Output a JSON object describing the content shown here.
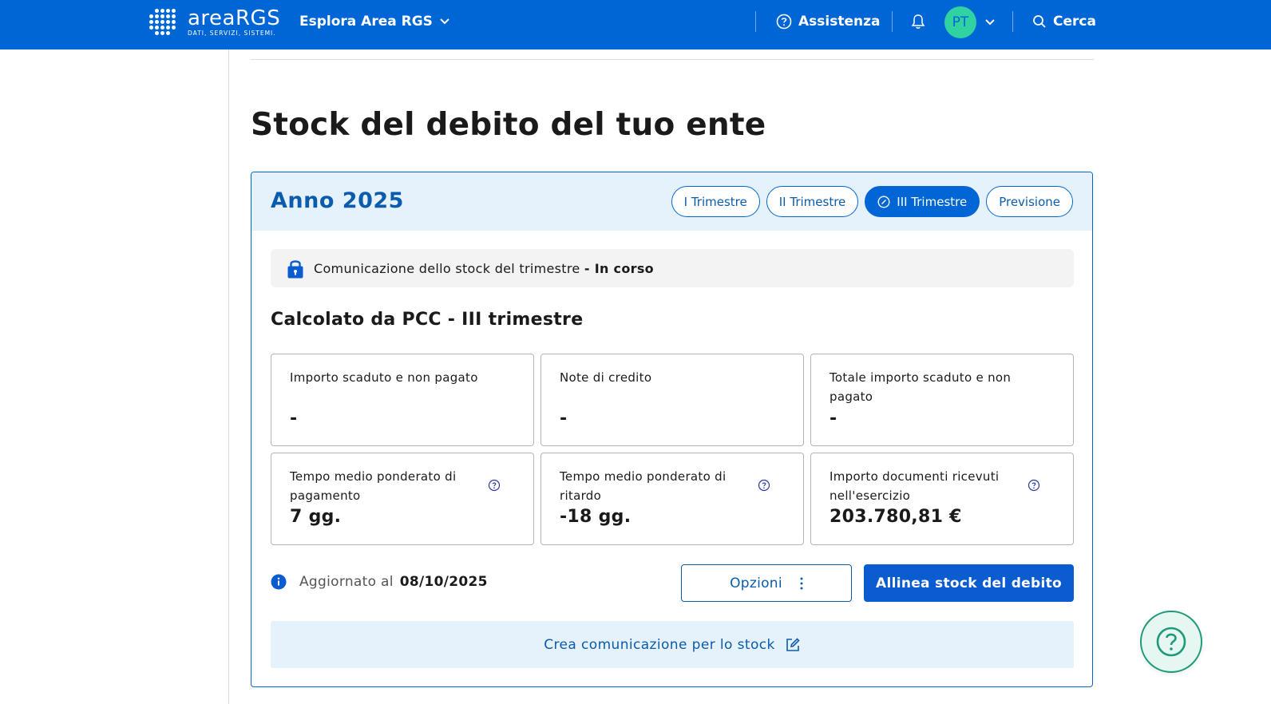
{
  "header": {
    "logo_name": "areaRGS",
    "logo_tagline": "DATI, SERVIZI, SISTEMI.",
    "explore_label": "Esplora Area RGS",
    "help_label": "Assistenza",
    "avatar_initials": "PT",
    "search_label": "Cerca",
    "icons": [
      "grid-dots-icon",
      "chevron-down-icon",
      "question-circle-icon",
      "bell-icon",
      "search-icon"
    ]
  },
  "page": {
    "title": "Stock del debito del tuo ente"
  },
  "card": {
    "year_label": "Anno 2025",
    "tabs": [
      {
        "label": "I Trimestre",
        "active": false
      },
      {
        "label": "II Trimestre",
        "active": false
      },
      {
        "label": "III Trimestre",
        "active": true
      },
      {
        "label": "Previsione",
        "active": false
      }
    ],
    "notice": {
      "text": "Comunicazione dello stock del trimestre",
      "status": "- In corso",
      "icon": "lock-icon"
    },
    "section_title": "Calcolato da PCC - III trimestre",
    "metrics": [
      {
        "label": "Importo scaduto e non pagato",
        "value": "-"
      },
      {
        "label": "Note di credito",
        "value": "-"
      },
      {
        "label": "Totale importo scaduto e non pagato",
        "value": "-"
      },
      {
        "label": "Tempo medio ponderato di pagamento",
        "value": "7 gg."
      },
      {
        "label": "Tempo medio ponderato di ritardo",
        "value": "-18 gg."
      },
      {
        "label": "Importo documenti ricevuti nell'esercizio",
        "value": "203.780,81 €"
      }
    ],
    "updated_label": "Aggiornato al",
    "updated_date": "08/10/2025",
    "options_label": "Opzioni",
    "align_label": "Allinea stock del debito",
    "create_label": "Crea comunicazione per lo stock"
  },
  "colors": {
    "brand_blue": "#0066d6",
    "light_blue_bg": "#e5f1fb",
    "avatar_green": "#2fd2a0",
    "fab_teal": "#1c9a7a"
  }
}
